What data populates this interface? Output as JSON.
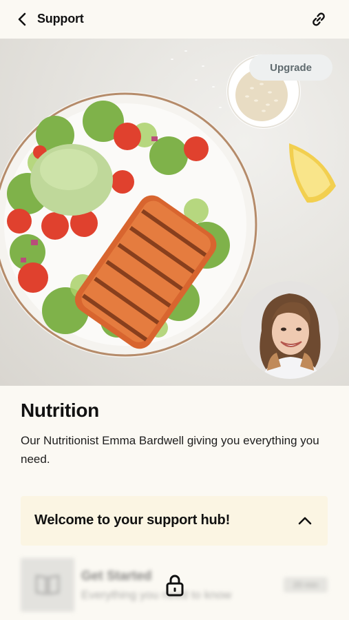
{
  "header": {
    "title": "Support",
    "back_icon": "chevron-left-icon",
    "share_icon": "link-icon"
  },
  "hero": {
    "upgrade_label": "Upgrade",
    "image": "salmon-salad-bowl-photo",
    "avatar": "nutritionist-portrait"
  },
  "main": {
    "title": "Nutrition",
    "description": "Our Nutritionist Emma Bardwell giving you everything you need."
  },
  "hub": {
    "title": "Welcome to your support hub!",
    "chevron_icon": "chevron-up-icon"
  },
  "lesson": {
    "title": "Get Started",
    "subtitle": "Everything you need to know",
    "duration": "20 min",
    "locked": true,
    "lock_icon": "lock-icon",
    "thumb_icon": "book-icon"
  },
  "colors": {
    "background": "#fbf9f3",
    "hub_background": "#fbf5e3",
    "upgrade_background": "#eef0f0"
  }
}
